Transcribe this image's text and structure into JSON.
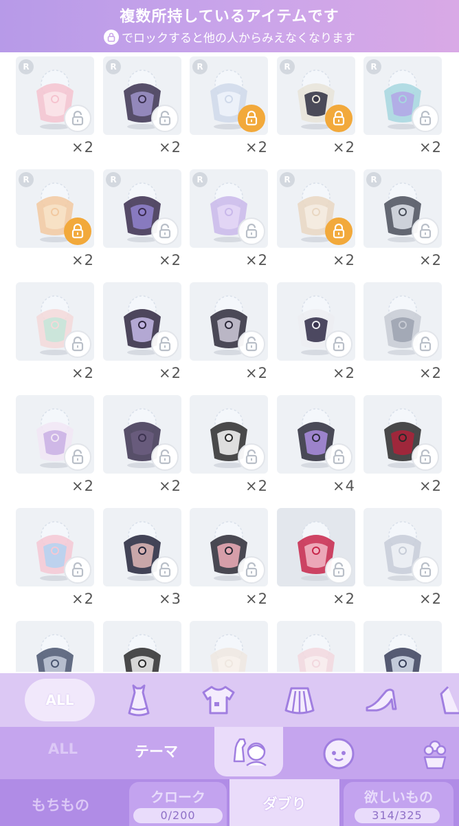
{
  "header": {
    "line1": "複数所持しているアイテムです",
    "line2_suffix": "でロックすると他の人からみえなくなります"
  },
  "grid": {
    "rarity_label": "R",
    "rows": [
      [
        "×2",
        "×2",
        "×2",
        "×2",
        "×2"
      ],
      [
        "×2",
        "×2",
        "×2",
        "×2",
        "×2"
      ],
      [
        "×2",
        "×2",
        "×2",
        "×2",
        "×2"
      ],
      [
        "×2",
        "×2",
        "×2",
        "×4",
        "×2"
      ],
      [
        "×2",
        "×3",
        "×2",
        "×2",
        "×2"
      ]
    ],
    "locked": [
      [
        0,
        2
      ],
      [
        0,
        3
      ],
      [
        1,
        0
      ],
      [
        1,
        3
      ]
    ],
    "items": [
      [
        "headdress-bonnet",
        "outfit-set",
        "wings-accessory",
        "helmet-accessory",
        "hair-wig"
      ],
      [
        "star-hairpins",
        "witch-hat-outfit",
        "magic-wand",
        "cloud-hairpin",
        "face-eyes"
      ],
      [
        "floral-dress",
        "dark-dress",
        "dark-tunic-dress",
        "white-jacket-outfit",
        "silver-coat"
      ],
      [
        "white-coat",
        "purple-cloak",
        "black-white-dress",
        "striped-jacket",
        "red-black-coat"
      ],
      [
        "pastel-shoes",
        "black-shoes",
        "star-boots",
        "red-heels",
        "silver-shoes"
      ],
      [
        "blue-boots",
        "black-boots",
        "white-boots",
        "pink-shoes",
        "navy-shoes"
      ]
    ]
  },
  "category_bar": {
    "all_label": "ALL",
    "icons": [
      "dress-icon",
      "top-shirt-icon",
      "skirt-icon",
      "heel-shoe-icon",
      "jacket-icon"
    ]
  },
  "sub_tabs": {
    "all_label": "ALL",
    "theme_label": "テーマ",
    "icons": [
      "coordinate-icon",
      "face-icon",
      "accessory-flower-icon"
    ]
  },
  "bottom_tabs": {
    "owned_label": "もちもの",
    "closet_label": "クローク",
    "closet_count": "0/200",
    "duplicates_label": "ダブり",
    "wishlist_label": "欲しいもの",
    "wishlist_count": "314/325"
  },
  "colors": {
    "accent_purple": "#b08ce6",
    "lock_orange": "#f2a93b"
  }
}
